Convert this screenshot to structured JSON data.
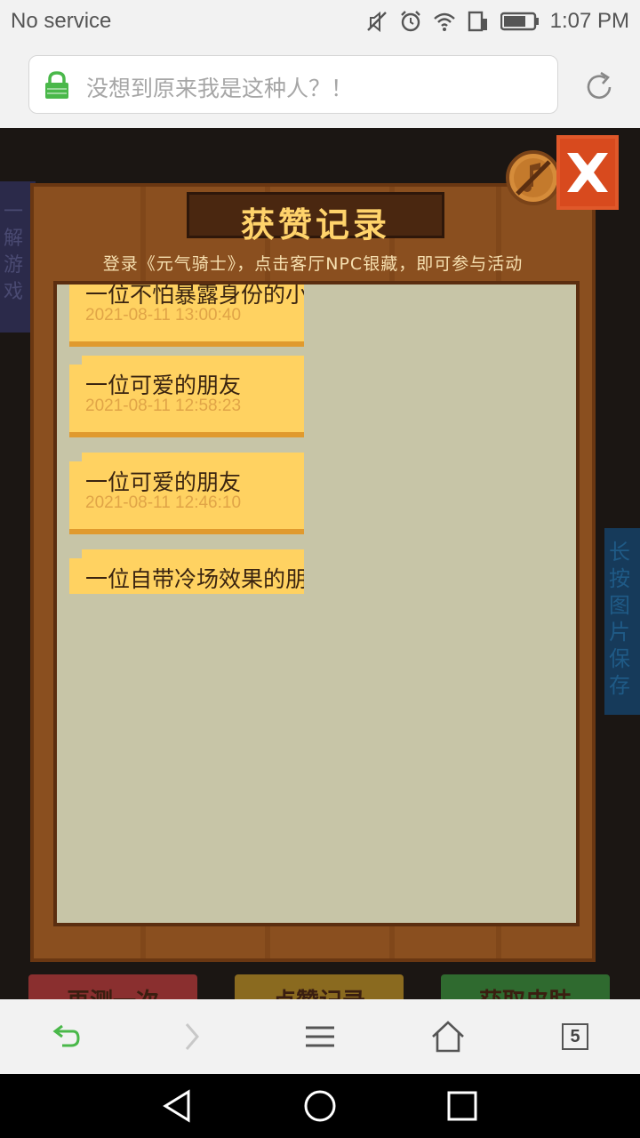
{
  "status_bar": {
    "carrier": "No service",
    "time": "1:07 PM",
    "icons": [
      "mute-icon",
      "alarm-icon",
      "wifi-icon",
      "data-icon",
      "battery-icon"
    ]
  },
  "address_bar": {
    "title": "没想到原来我是这种人？！",
    "lock_icon": "lock-icon",
    "reload_icon": "reload-icon"
  },
  "background": {
    "left_text": "一解游戏",
    "right_text": "长按图片保存",
    "bottom_buttons": [
      "再测一次",
      "点赞记录",
      "获取皮肤"
    ]
  },
  "panel": {
    "title": "获赞记录",
    "subtitle": "登录《元气骑士》，点击客厅NPC银藏，即可参与活动",
    "records": [
      {
        "name": "一位不怕暴露身份的小",
        "time": "2021-08-11 13:00:40"
      },
      {
        "name": "一位可爱的朋友",
        "time": "2021-08-11 12:58:23"
      },
      {
        "name": "一位可爱的朋友",
        "time": "2021-08-11 12:46:10"
      },
      {
        "name": "一位自带冷场效果的朋",
        "time": ""
      }
    ],
    "music_icon": "music-muted-icon",
    "close_icon": "close-icon"
  },
  "toolbar": {
    "tab_count": "5",
    "icons": [
      "back-icon",
      "forward-icon",
      "menu-icon",
      "home-icon",
      "tabs-icon"
    ]
  },
  "colors": {
    "panel_wood": "#8a4f1f",
    "card_yellow": "#ffd261",
    "title_gold": "#ffd36b",
    "close_orange": "#e0582a"
  }
}
